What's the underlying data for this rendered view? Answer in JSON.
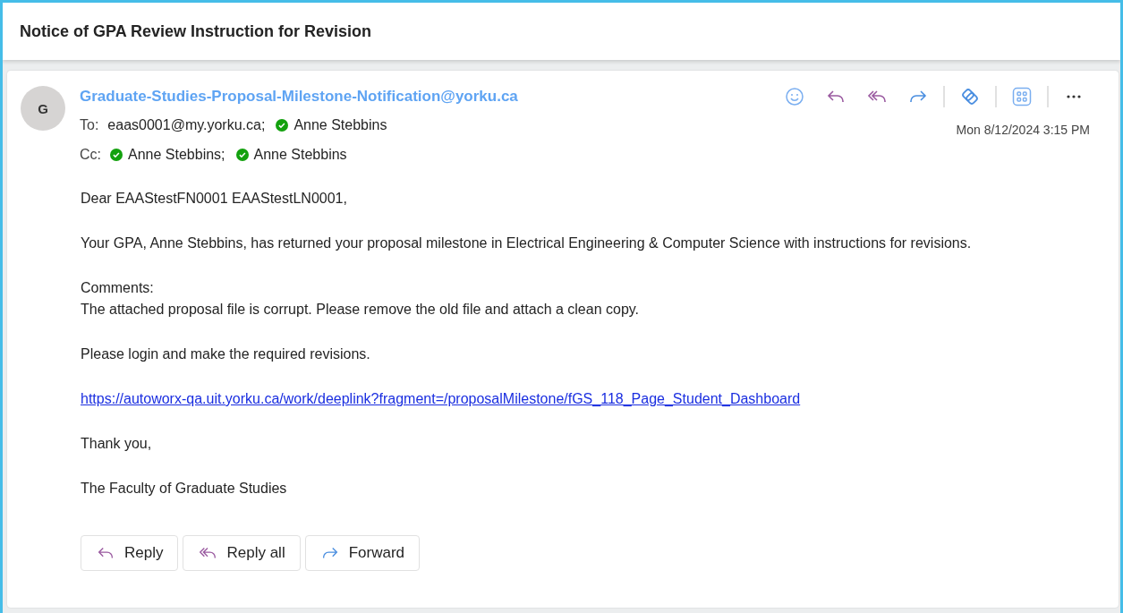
{
  "subject": "Notice of GPA Review Instruction for Revision",
  "sender": {
    "initial": "G",
    "address": "Graduate-Studies-Proposal-Milestone-Notification@yorku.ca"
  },
  "to": {
    "label": "To:",
    "recipients": [
      {
        "name": "eaas0001@my.yorku.ca;",
        "verified": false
      },
      {
        "name": "Anne Stebbins",
        "verified": true
      }
    ]
  },
  "cc": {
    "label": "Cc:",
    "recipients": [
      {
        "name": "Anne Stebbins;",
        "verified": true
      },
      {
        "name": "Anne Stebbins",
        "verified": true
      }
    ]
  },
  "date": "Mon 8/12/2024 3:15 PM",
  "body": [
    {
      "kind": "text",
      "lines": [
        "Dear EAAStestFN0001 EAAStestLN0001,"
      ]
    },
    {
      "kind": "text",
      "lines": [
        "Your GPA, Anne Stebbins, has returned your proposal milestone in Electrical Engineering & Computer Science with instructions for revisions."
      ]
    },
    {
      "kind": "text",
      "lines": [
        "Comments:",
        "The attached proposal file is corrupt. Please remove the old file and attach a clean copy."
      ]
    },
    {
      "kind": "text",
      "lines": [
        "Please login and make the required revisions."
      ]
    },
    {
      "kind": "link",
      "lines": [
        "https://autoworx-qa.uit.yorku.ca/work/deeplink?fragment=/proposalMilestone/fGS_118_Page_Student_Dashboard"
      ]
    },
    {
      "kind": "text",
      "lines": [
        "Thank you,"
      ]
    },
    {
      "kind": "text",
      "lines": [
        "The Faculty of Graduate Studies"
      ]
    }
  ],
  "actions": [
    {
      "kind": "reply",
      "label": "Reply"
    },
    {
      "kind": "reply_all",
      "label": "Reply all"
    },
    {
      "kind": "forward",
      "label": "Forward"
    }
  ]
}
